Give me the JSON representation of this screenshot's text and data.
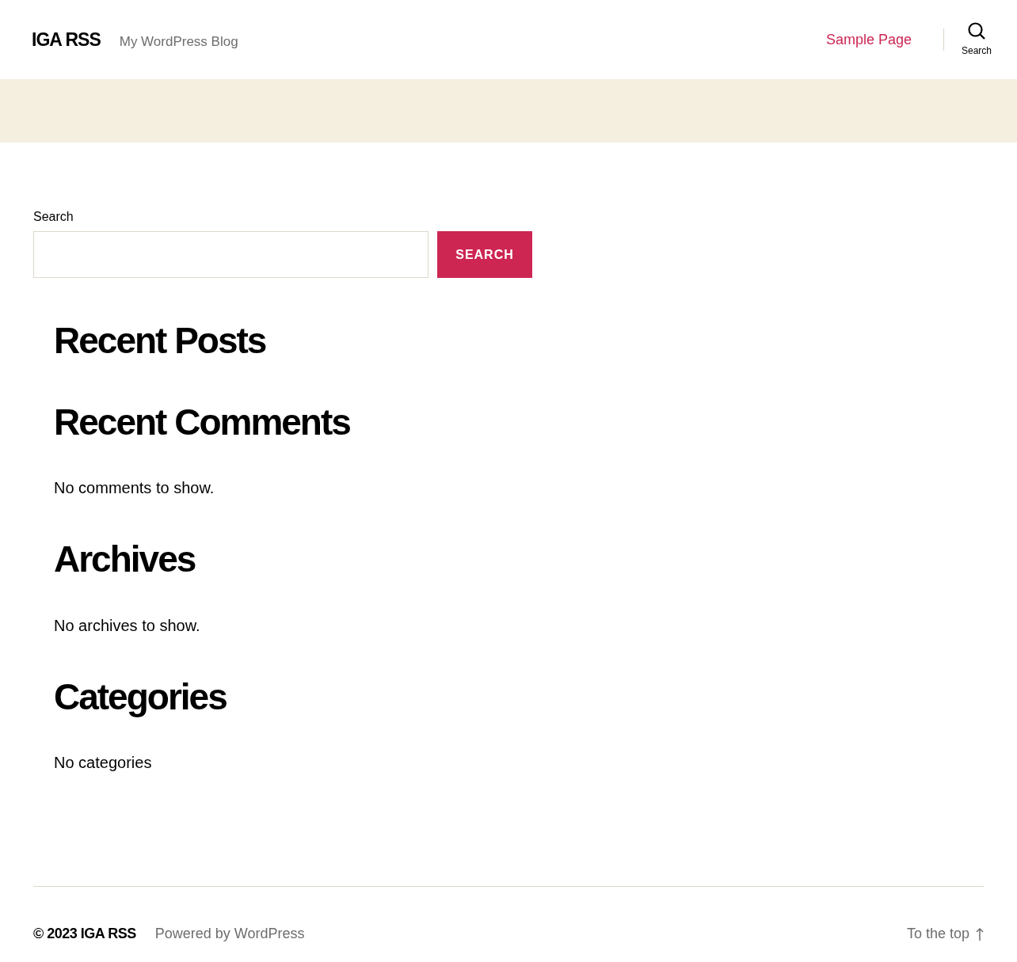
{
  "header": {
    "site_title": "IGA RSS",
    "tagline": "My WordPress Blog",
    "nav": [
      {
        "label": "Sample Page"
      }
    ],
    "search_toggle": {
      "label": "Search"
    }
  },
  "search_widget": {
    "label": "Search",
    "button": "SEARCH"
  },
  "widgets": [
    {
      "title": "Recent Posts"
    },
    {
      "title": "Recent Comments",
      "text": "No comments to show."
    },
    {
      "title": "Archives",
      "text": "No archives to show."
    },
    {
      "title": "Categories",
      "text": "No categories"
    }
  ],
  "footer": {
    "copyright": "© 2023 IGA RSS",
    "powered": "Powered by WordPress",
    "to_top": "To the top"
  }
}
